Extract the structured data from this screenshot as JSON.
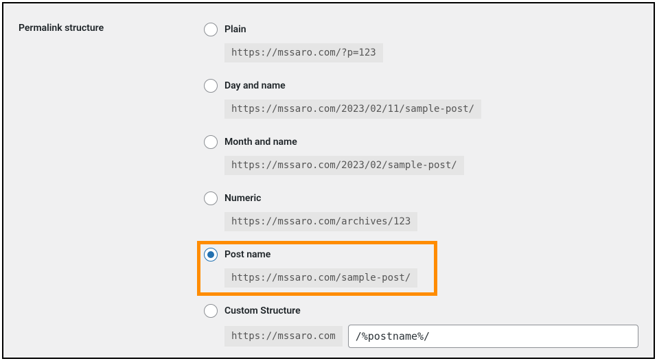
{
  "section_label": "Permalink structure",
  "options": {
    "plain": {
      "label": "Plain",
      "example": "https://mssaro.com/?p=123"
    },
    "day_name": {
      "label": "Day and name",
      "example": "https://mssaro.com/2023/02/11/sample-post/"
    },
    "month_name": {
      "label": "Month and name",
      "example": "https://mssaro.com/2023/02/sample-post/"
    },
    "numeric": {
      "label": "Numeric",
      "example": "https://mssaro.com/archives/123"
    },
    "post_name": {
      "label": "Post name",
      "example": "https://mssaro.com/sample-post/"
    },
    "custom": {
      "label": "Custom Structure",
      "prefix": "https://mssaro.com",
      "value": "/%postname%/"
    }
  },
  "selected": "post_name"
}
